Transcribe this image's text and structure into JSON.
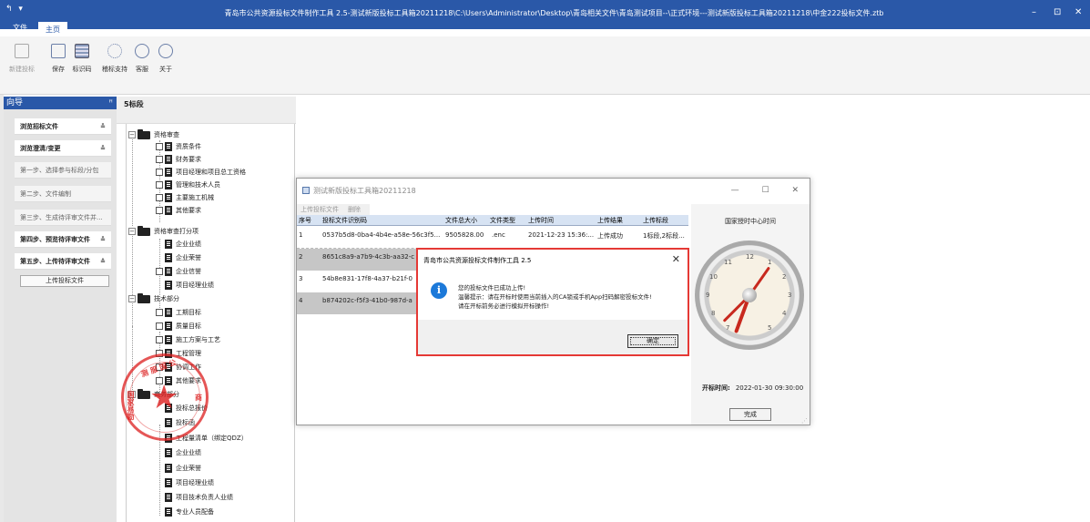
{
  "app": {
    "title": "青岛市公共资源投标文件制作工具 2.5-测试新版投标工具箱20211218\\C:\\Users\\Administrator\\Desktop\\青岛相关文件\\青岛测试项目--\\正式环境---测试新版投标工具箱20211218\\中金222投标文件.ztb",
    "sys_icons": "↰ ▾",
    "win_min": "–",
    "win_max": "⊡",
    "win_close": "✕"
  },
  "menu": {
    "tabs": [
      {
        "label": "文件"
      },
      {
        "label": "主页"
      }
    ]
  },
  "ribbon": {
    "buttons": [
      {
        "label": "新建投标",
        "icon": "new-doc-icon"
      },
      {
        "label": "保存",
        "icon": "save-icon"
      },
      {
        "label": "标识码",
        "icon": "id-code-icon"
      },
      {
        "label": "稽标支持",
        "icon": "bulb-icon"
      },
      {
        "label": "客服",
        "icon": "service-icon"
      },
      {
        "label": "关于",
        "icon": "info-icon"
      }
    ]
  },
  "guide": {
    "title": "向导",
    "pin": "ꟸ",
    "items": [
      {
        "label": "浏览招标文件",
        "chevron": "≚"
      },
      {
        "label": "浏览澄清/变更",
        "chevron": "≚"
      },
      {
        "label": "第一步、选择参与标段/分包"
      },
      {
        "label": "第二步、文件编制"
      },
      {
        "label": "第三步、生成待评审文件并..."
      },
      {
        "label": "第四步、预览待评审文件",
        "chevron": "≚"
      },
      {
        "label": "第五步、上传待评审文件",
        "chevron": "≙"
      }
    ],
    "upload_button": "上传投标文件"
  },
  "tree": {
    "section_title": "5标段",
    "groups": [
      {
        "label": "资格审查",
        "items": [
          "资质条件",
          "财务要求",
          "项目经理和项目总工资格",
          "管理和技术人员",
          "主要施工机械",
          "其他要求"
        ]
      },
      {
        "label": "资格审查打分项",
        "items": [
          "企业业绩",
          "企业荣誉",
          "企业信誉",
          "项目经理业绩"
        ]
      },
      {
        "label": "技术部分",
        "items": [
          "工期目标",
          "质量目标",
          "施工方案与工艺",
          "工程管理",
          "协调工作",
          "其他要求"
        ]
      },
      {
        "label": "商务部分",
        "items": [
          "投标总报价",
          "投标函",
          "工程量清单（绑定QDZ）",
          "企业业绩",
          "企业荣誉",
          "项目经理业绩",
          "项目技术负责人业绩",
          "专业人员配备"
        ]
      }
    ]
  },
  "seal": {
    "text_top": "测  服  国  公",
    "text_left": "国家易勘",
    "text_right": "商"
  },
  "upload_window": {
    "title": "测试新版投标工具箱20211218",
    "min": "—",
    "max": "☐",
    "close": "✕",
    "toolbar": [
      "上传投标文件",
      "删除"
    ],
    "columns": [
      "序号",
      "投标文件识别码",
      "文件总大小",
      "文件类型",
      "上传时间",
      "上传结果",
      "上传标段"
    ],
    "rows": [
      {
        "no": "1",
        "code": "0537b5d8-0ba4-4b4e-a58e-56c3f5...",
        "size": "9505828.00",
        "type": ".enc",
        "time": "2021-12-23 15:36:...",
        "result": "上传成功",
        "sections": "1标段,2标段..."
      },
      {
        "no": "2",
        "code": "8651c8a9-a7b9-4c3b-aa32-c",
        "size": "",
        "type": "",
        "time": "",
        "result": "",
        "sections": ""
      },
      {
        "no": "3",
        "code": "54b8e831-17f8-4a37-b21f-0",
        "size": "",
        "type": "",
        "time": "",
        "result": "",
        "sections": ""
      },
      {
        "no": "4",
        "code": "b874202c-f5f3-41b0-987d-a",
        "size": "",
        "type": "",
        "time": "",
        "result": "",
        "sections": ""
      }
    ],
    "clock_title": "国家授时中心时间",
    "clock_numbers": [
      "12",
      "1",
      "2",
      "3",
      "4",
      "5",
      "7",
      "8",
      "9",
      "10",
      "11"
    ],
    "bid_time_label": "开标时间:",
    "bid_time_value": "2022-01-30 09:30:00",
    "done_button": "完成",
    "resize_grip": "⋰"
  },
  "message_box": {
    "title": "青岛市公共资源投标文件制作工具 2.5",
    "close": "✕",
    "icon_glyph": "i",
    "line1": "您的投标文件已成功上传!",
    "line2": "温馨提示：请在开标时使用当前插入的CA锁或手机App扫码解密投标文件!",
    "line3": "请在开标前务必进行模拟开标操作!",
    "ok_button": "确定"
  }
}
